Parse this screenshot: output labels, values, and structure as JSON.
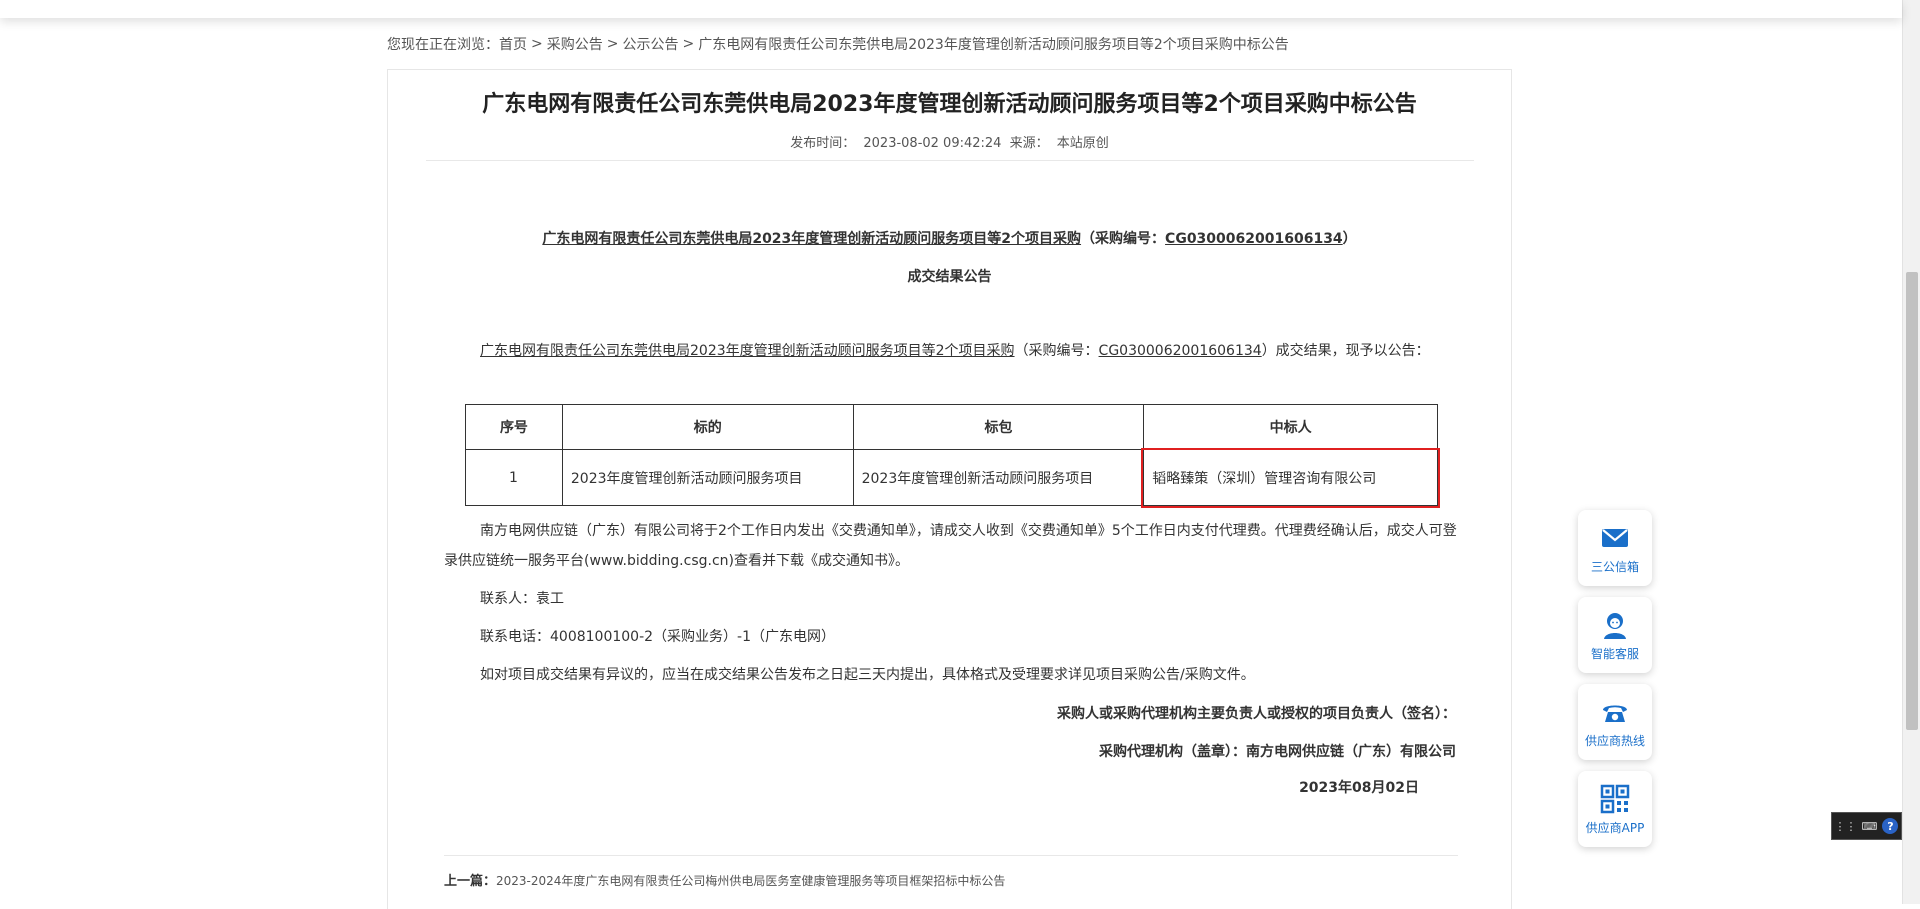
{
  "breadcrumb": {
    "prefix": "您现在正在浏览：",
    "items": [
      "首页",
      "采购公告",
      "公示公告",
      "广东电网有限责任公司东莞供电局2023年度管理创新活动顾问服务项目等2个项目采购中标公告"
    ]
  },
  "article": {
    "title": "广东电网有限责任公司东莞供电局2023年度管理创新活动顾问服务项目等2个项目采购中标公告",
    "publish_label": "发布时间：",
    "publish_time": "2023-08-02 09:42:24",
    "source_label": "来源：",
    "source": "本站原创"
  },
  "doc": {
    "heading_project": "广东电网有限责任公司东莞供电局2023年度管理创新活动顾问服务项目等2个项目采购",
    "heading_code_prefix": "（采购编号：",
    "code": "CG0300062001606134",
    "heading_code_suffix": "）",
    "subheading": "成交结果公告",
    "intro_project": "广东电网有限责任公司东莞供电局2023年度管理创新活动顾问服务项目等2个项目采购",
    "intro_mid": "（采购编号：",
    "intro_tail": "）成交结果，现予以公告：",
    "table": {
      "headers": [
        "序号",
        "标的",
        "标包",
        "中标人"
      ],
      "rows": [
        [
          "1",
          "2023年度管理创新活动顾问服务项目",
          "2023年度管理创新活动顾问服务项目",
          "韬略臻策（深圳）管理咨询有限公司"
        ]
      ]
    },
    "notice": "南方电网供应链（广东）有限公司将于2个工作日内发出《交费通知单》，请成交人收到《交费通知单》5个工作日内支付代理费。代理费经确认后，成交人可登录供应链统一服务平台(www.bidding.csg.cn)查看并下载《成交通知书》。",
    "contact": "联系人：袁工",
    "phone": "联系电话：4008100100-2（采购业务）-1（广东电网）",
    "objection": "如对项目成交结果有异议的，应当在成交结果公告发布之日起三天内提出，具体格式及受理要求详见项目采购公告/采购文件。",
    "signature_line": "采购人或采购代理机构主要负责人或授权的项目负责人（签名）：",
    "agency_line": "采购代理机构（盖章）：南方电网供应链（广东）有限公司",
    "date": "2023年08月02日"
  },
  "prev": {
    "label": "上一篇：",
    "title": "2023-2024年度广东电网有限责任公司梅州供电局医务室健康管理服务等项目框架招标中标公告"
  },
  "side_widgets": [
    {
      "icon": "mail-icon",
      "label": "三公信箱"
    },
    {
      "icon": "agent-icon",
      "label": "智能客服"
    },
    {
      "icon": "phone-icon",
      "label": "供应商热线"
    },
    {
      "icon": "qrcode-icon",
      "label": "供应商APP"
    }
  ],
  "ime": {
    "help": "?"
  },
  "colors": {
    "accent": "#1a6fc9",
    "highlight": "#e02020"
  }
}
